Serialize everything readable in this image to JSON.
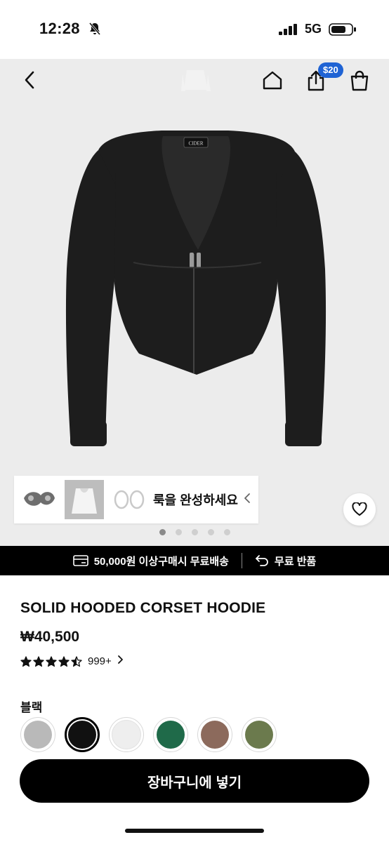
{
  "status_bar": {
    "time": "12:28",
    "network": "5G"
  },
  "header": {
    "credit_badge": "$20"
  },
  "product_image": {
    "brand_tag": "CIDER"
  },
  "complete_look": {
    "text": "룩을 완성하세요"
  },
  "carousel": {
    "total": 5,
    "active": 1
  },
  "promo": {
    "shipping": "50,000원 이상구매시 무료배송",
    "returns": "무료 반품"
  },
  "product": {
    "title": "SOLID HOODED CORSET HOODIE",
    "price": "₩40,500",
    "rating": 4.5,
    "review_count": "999+"
  },
  "color": {
    "selected_label": "블랙",
    "swatches": [
      "#b9b9b9",
      "#111111",
      "#eeeeee",
      "#1f6a49",
      "#8c6a5c",
      "#6b7a4d"
    ],
    "selected_index": 1
  },
  "cta": {
    "add_to_cart": "장바구니에 넣기"
  }
}
